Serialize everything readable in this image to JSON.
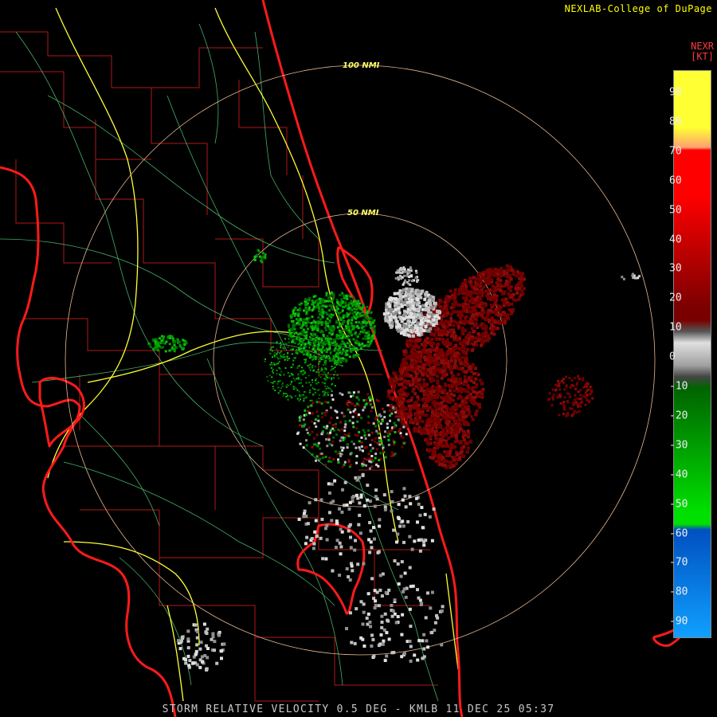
{
  "credit": "NEXLAB-College of DuPage",
  "legend": {
    "product": "NEXR",
    "unit": "[KT]",
    "ticks": [
      "90",
      "80",
      "70",
      "60",
      "50",
      "40",
      "30",
      "20",
      "10",
      "0",
      "-10",
      "-20",
      "-30",
      "-40",
      "-50",
      "-60",
      "-70",
      "-80",
      "-90"
    ],
    "colors": {
      "high": "#ffff33",
      "orange": "#ffa070",
      "red": "#ff0000",
      "darkred": "#7a0000",
      "gray": "#a0a0a0",
      "darkgreen": "#006400",
      "green": "#00e000",
      "blue": "#0050c0",
      "lightblue": "#10a0ff"
    }
  },
  "rings": {
    "inner": "50 NMI",
    "outer": "100 NMI"
  },
  "caption": "STORM RELATIVE VELOCITY 0.5 DEG - KMLB 11 DEC 25 05:37",
  "colors": {
    "coastline": "#ff1a1a",
    "county": "#b01818",
    "roads_minor": "#4fd07a",
    "roads_major": "#ffff33",
    "rings": "#e8b890",
    "outbound": "#7a0000",
    "inbound": "#00a000",
    "gray_echo": "#c0c0c0"
  }
}
